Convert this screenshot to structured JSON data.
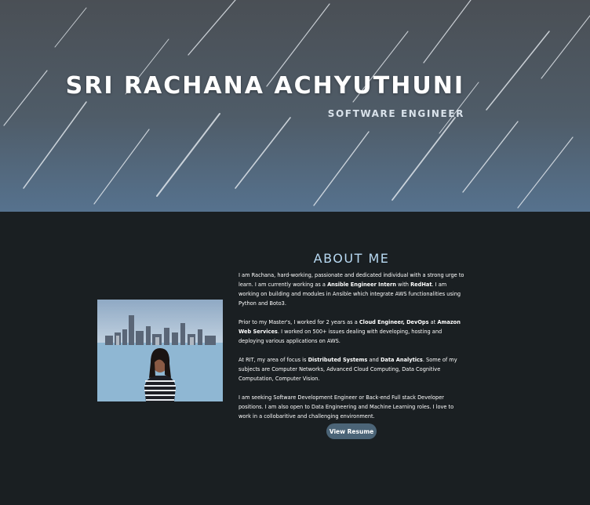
{
  "hero": {
    "name": "SRI RACHANA ACHYUTHUNI",
    "title": "SOFTWARE ENGINEER"
  },
  "about": {
    "heading": "ABOUT ME",
    "p1": {
      "a": "I am Rachana, hard-working, passionate and dedicated individual with a strong urge to learn. I am currently working as a ",
      "role": "Ansible Engineer Intern",
      "b": " with ",
      "company": "RedHat",
      "c": ". I am working on building and modules in Ansible which integrate AWS functionalities using Python and Boto3."
    },
    "p2": {
      "a": "Prior to my Master's, I worked for 2 years as a ",
      "role": "Cloud Engineer, DevOps",
      "b": " at ",
      "company": "Amazon Web Services",
      "c": ". I worked on 500+ issues dealing with developing, hosting and deploying various applications on AWS."
    },
    "p3": {
      "a": "At RIT, my area of focus is ",
      "focus1": "Distributed Systems",
      "b": " and ",
      "focus2": "Data Analytics",
      "c": ". Some of my subjects are Computer Networks, Advanced Cloud Computing, Data Cognitive Computation, Computer Vision."
    },
    "p4": "I  am seeking Software Development Engineer or Back-end Full stack Developer positions. I am also open to Data Engineering and Machine Learning roles. I love to work in a collobaritive and challenging environment.",
    "resume_button": "View Resume"
  },
  "colors": {
    "page_bg": "#1a1f22",
    "heading_accent": "#b8d9f2",
    "button_bg": "#4b6477"
  }
}
